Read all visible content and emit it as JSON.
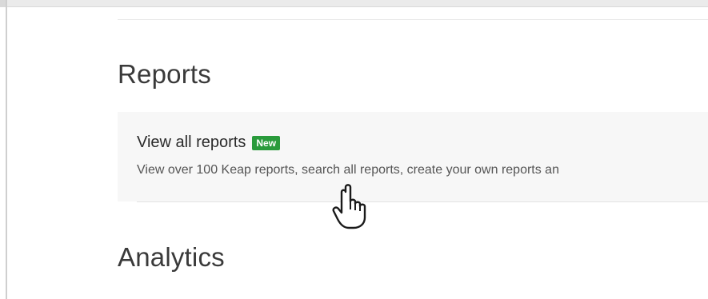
{
  "sections": {
    "reports_heading": "Reports",
    "analytics_heading": "Analytics"
  },
  "report_card": {
    "title": "View all reports",
    "badge": "New",
    "description": "View over 100 Keap reports, search all reports, create your own reports an"
  },
  "colors": {
    "badge_bg": "#2a9b3c",
    "card_bg": "#f7f7f7",
    "heading_text": "#3a3a3a"
  },
  "icons": {
    "cursor": "hand-pointer-icon"
  }
}
